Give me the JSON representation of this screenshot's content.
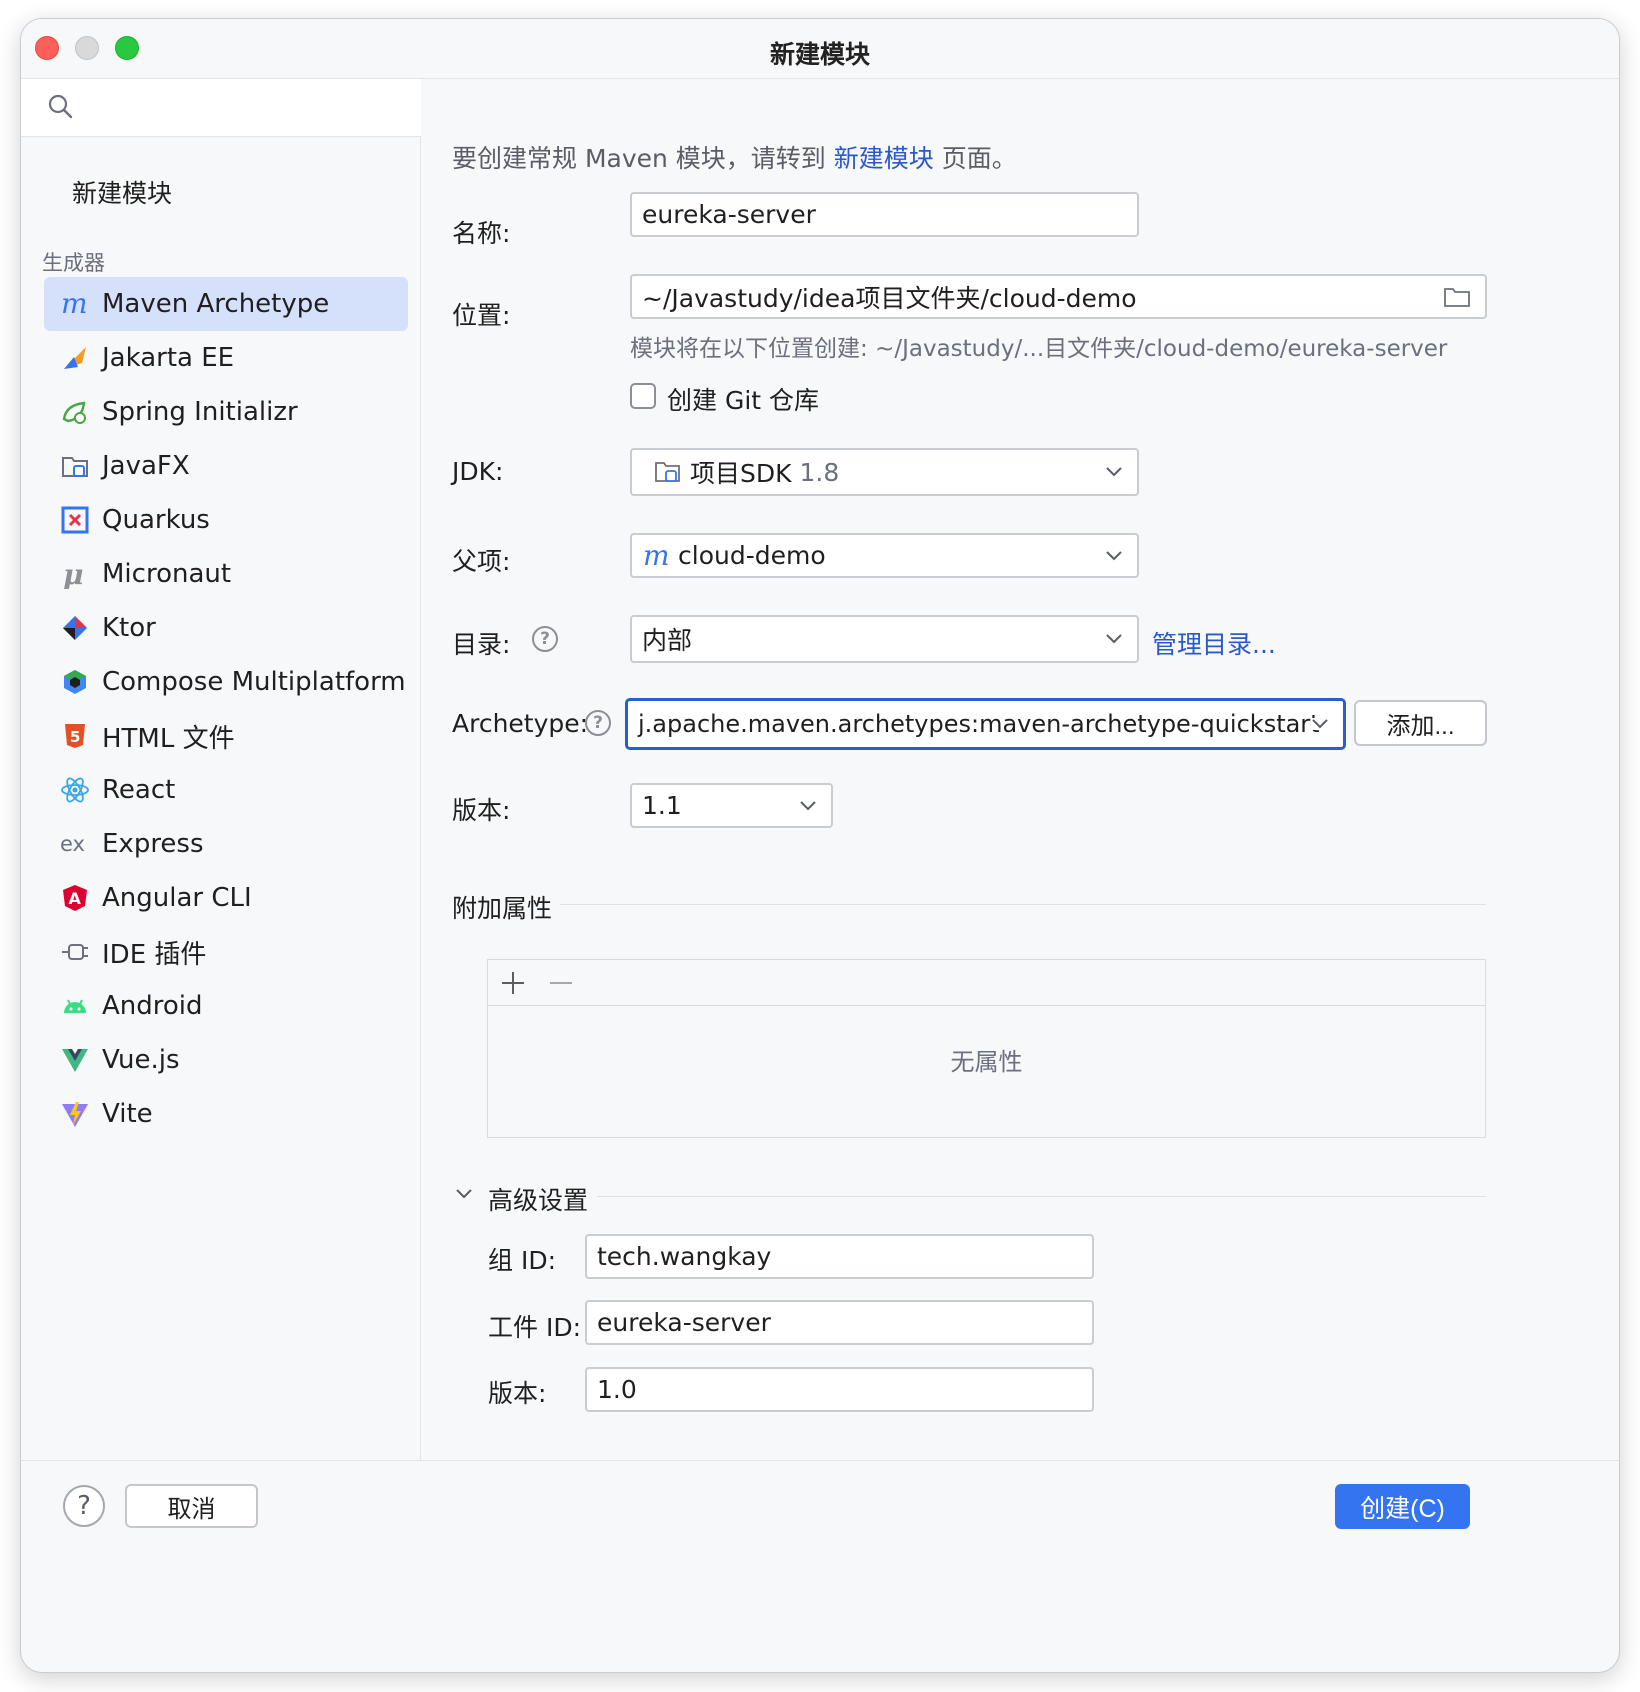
{
  "window": {
    "title": "新建模块"
  },
  "sidebar": {
    "search": {
      "placeholder": ""
    },
    "top_item": "新建模块",
    "section_label": "生成器",
    "generators": [
      {
        "label": "Maven Archetype",
        "icon": "maven-icon",
        "selected": true
      },
      {
        "label": "Jakarta EE",
        "icon": "jakarta-ee-icon"
      },
      {
        "label": "Spring Initializr",
        "icon": "spring-icon"
      },
      {
        "label": "JavaFX",
        "icon": "javafx-icon"
      },
      {
        "label": "Quarkus",
        "icon": "quarkus-icon"
      },
      {
        "label": "Micronaut",
        "icon": "micronaut-icon"
      },
      {
        "label": "Ktor",
        "icon": "ktor-icon"
      },
      {
        "label": "Compose Multiplatform",
        "icon": "compose-icon"
      },
      {
        "label": "HTML 文件",
        "icon": "html5-icon"
      },
      {
        "label": "React",
        "icon": "react-icon"
      },
      {
        "label": "Express",
        "icon": "express-icon"
      },
      {
        "label": "Angular CLI",
        "icon": "angular-icon"
      },
      {
        "label": "IDE 插件",
        "icon": "plugin-icon"
      },
      {
        "label": "Android",
        "icon": "android-icon"
      },
      {
        "label": "Vue.js",
        "icon": "vue-icon"
      },
      {
        "label": "Vite",
        "icon": "vite-icon"
      }
    ]
  },
  "main": {
    "info": {
      "prefix": "要创建常规 Maven 模块，请转到 ",
      "link": "新建模块",
      "suffix": " 页面。"
    },
    "name": {
      "label": "名称:",
      "value": "eureka-server"
    },
    "location": {
      "label": "位置:",
      "value": "~/Javastudy/idea项目文件夹/cloud-demo",
      "hint": "模块将在以下位置创建: ~/Javastudy/...目文件夹/cloud-demo/eureka-server"
    },
    "git": {
      "label": "创建 Git 仓库",
      "checked": false
    },
    "jdk": {
      "label": "JDK:",
      "value": "项目SDK",
      "version": "1.8"
    },
    "parent": {
      "label": "父项:",
      "value": "cloud-demo"
    },
    "catalog": {
      "label": "目录:",
      "value": "内部",
      "manage_link": "管理目录..."
    },
    "archetype": {
      "label": "Archetype:",
      "value": "j.apache.maven.archetypes:maven-archetype-quickstart",
      "add_button": "添加..."
    },
    "version": {
      "label": "版本:",
      "value": "1.1"
    },
    "properties": {
      "title": "附加属性",
      "empty_text": "无属性"
    },
    "advanced": {
      "title": "高级设置",
      "group_id": {
        "label": "组 ID:",
        "value": "tech.wangkay"
      },
      "artifact_id": {
        "label": "工件 ID:",
        "value": "eureka-server"
      },
      "version": {
        "label": "版本:",
        "value": "1.0"
      }
    }
  },
  "footer": {
    "help": "?",
    "cancel": "取消",
    "create": "创建(C)"
  },
  "colors": {
    "accent": "#3574f0",
    "link": "#2a59c9",
    "selection": "#d5e1fb",
    "focus_border": "#2d5cd1"
  }
}
